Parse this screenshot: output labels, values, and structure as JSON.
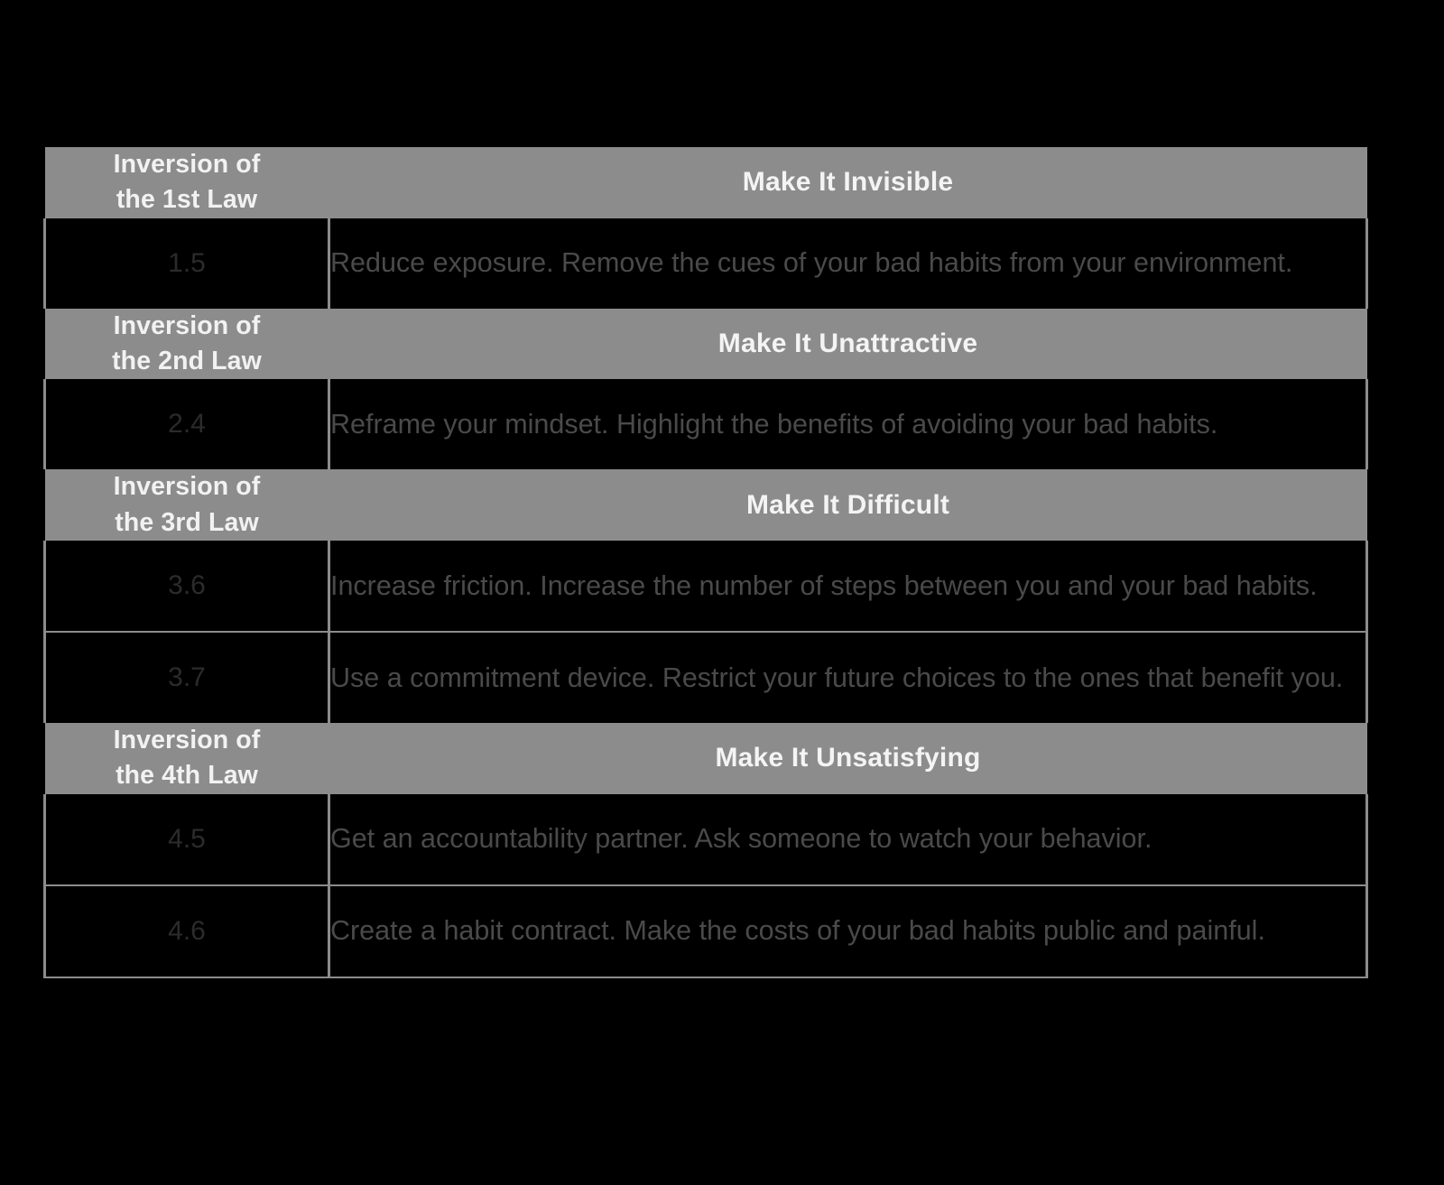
{
  "colors": {
    "page_background": "#000000",
    "header_band": "#8c8c8c",
    "header_text": "#f2f2f2",
    "body_text": "#4a4a4a",
    "number_text": "#2b2b2b",
    "grid_line": "#8c8c8c"
  },
  "table": {
    "sections": [
      {
        "law_label": "Inversion of\nthe 1st Law",
        "law_label_line1": "Inversion of",
        "law_label_line2": "the 1st Law",
        "law_title": "Make It Invisible",
        "items": [
          {
            "number": "1.5",
            "description": "Reduce exposure. Remove the cues of your bad habits from your environment."
          }
        ]
      },
      {
        "law_label": "Inversion of\nthe 2nd Law",
        "law_label_line1": "Inversion of",
        "law_label_line2": "the 2nd Law",
        "law_title": "Make It Unattractive",
        "items": [
          {
            "number": "2.4",
            "description": "Reframe your mindset. Highlight the benefits of avoiding your bad habits."
          }
        ]
      },
      {
        "law_label": "Inversion of\nthe 3rd Law",
        "law_label_line1": "Inversion of",
        "law_label_line2": "the 3rd Law",
        "law_title": "Make It Difficult",
        "items": [
          {
            "number": "3.6",
            "description": "Increase friction. Increase the number of steps between you and your bad habits."
          },
          {
            "number": "3.7",
            "description": "Use a commitment device. Restrict your future choices to the ones that benefit you."
          }
        ]
      },
      {
        "law_label": "Inversion of\nthe 4th Law",
        "law_label_line1": "Inversion of",
        "law_label_line2": "the 4th Law",
        "law_title": "Make It Unsatisfying",
        "items": [
          {
            "number": "4.5",
            "description": "Get an accountability partner. Ask someone to watch your behavior."
          },
          {
            "number": "4.6",
            "description": "Create a habit contract. Make the costs of your bad habits public and painful."
          }
        ]
      }
    ]
  }
}
